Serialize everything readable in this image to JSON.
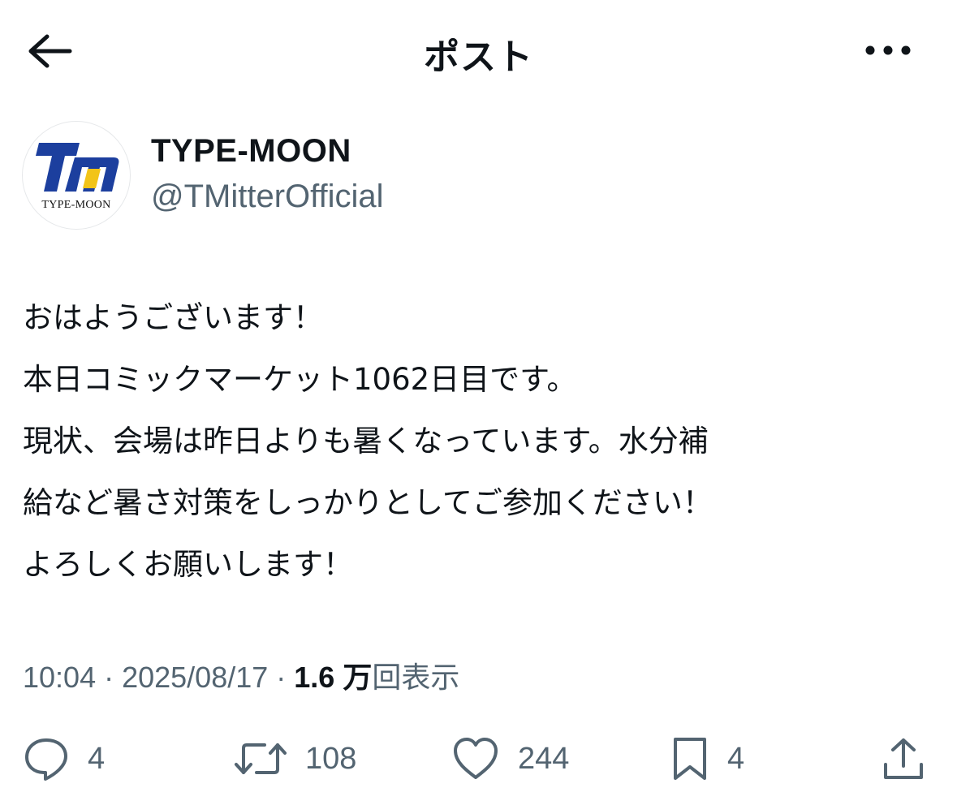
{
  "header": {
    "title": "ポスト"
  },
  "account": {
    "display_name": "TYPE-MOON",
    "handle": "@TMitterOfficial",
    "avatar_logo_text": "TYPE-MOON"
  },
  "tweet": {
    "lines": [
      "おはようございます！",
      "本日コミックマーケット1062日目です。",
      "現状、会場は昨日よりも暑くなっています。水分補",
      "給など暑さ対策をしっかりとしてご参加ください！",
      "よろしくお願いします！"
    ]
  },
  "meta": {
    "time": "10:04",
    "sep1": " · ",
    "date": "2025/08/17",
    "sep2": " · ",
    "views_count": "1.6 万",
    "views_label": "回表示"
  },
  "actions": {
    "reply_count": "4",
    "repost_count": "108",
    "like_count": "244",
    "bookmark_count": "4"
  },
  "icons": {
    "back": "arrow-left-icon",
    "more": "more-horizontal-icon",
    "reply": "speech-bubble-icon",
    "repost": "repost-arrows-icon",
    "like": "heart-icon",
    "bookmark": "bookmark-icon",
    "share": "share-upload-icon"
  },
  "colors": {
    "text": "#0f1419",
    "secondary": "#536471",
    "logo_blue": "#1c3f9e",
    "logo_yellow": "#f2c418"
  }
}
